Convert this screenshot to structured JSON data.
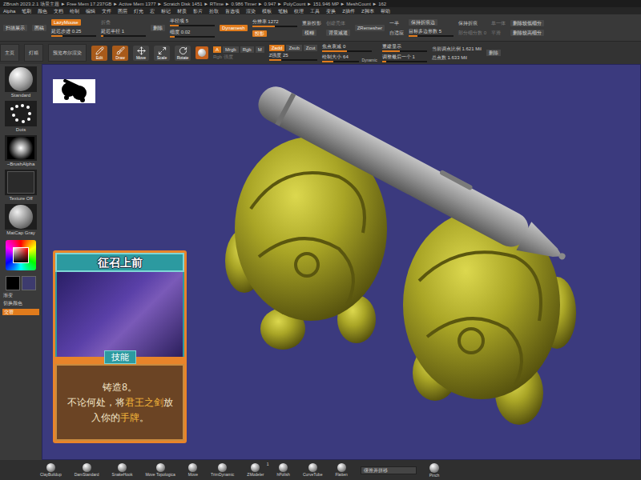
{
  "title_bar": "ZBrush 2023.2.1   场景主题   ► Free Mem 17.237GB   ► Active Mem 1377   ► Scratch Disk 1451   ► RTime ► 0.986  Timer ► 0.947   ► PolyCount ► 151.946 MP   ► MeshCount ► 162",
  "menu": [
    "Alpha",
    "笔刷",
    "颜色",
    "文档",
    "绘制",
    "编辑",
    "文件",
    "图层",
    "灯光",
    "宏",
    "标记",
    "材质",
    "影片",
    "拾取",
    "首选项",
    "渲染",
    "模板",
    "笔触",
    "纹理",
    "工具",
    "变换",
    "Z插件",
    "Z脚本",
    "帮助"
  ],
  "toolbar": [
    {
      "items": [
        {
          "kind": "button",
          "label": "扫描展示",
          "selected": false
        }
      ]
    },
    {
      "items": [
        {
          "kind": "button",
          "label": "图稿",
          "selected": false
        }
      ]
    },
    {
      "items": [
        {
          "kind": "button",
          "label": "LazyMouse",
          "selected": true
        },
        {
          "kind": "slider",
          "label": "延迟步进 0.25",
          "level": 0.25
        }
      ]
    },
    {
      "items": [
        {
          "kind": "text",
          "label": "折叠",
          "disabled": true
        },
        {
          "kind": "slider",
          "label": "延迟半径 1",
          "level": 0.05
        }
      ]
    },
    {
      "items": [
        {
          "kind": "button",
          "label": "删除",
          "selected": false
        }
      ]
    },
    {
      "items": [
        {
          "kind": "slider",
          "label": "半径项 5",
          "level": 0.2
        },
        {
          "kind": "slider",
          "label": "细度 0.02",
          "level": 0.1
        }
      ]
    },
    {
      "items": [
        {
          "kind": "button",
          "label": "Dynamesh",
          "selected": true
        }
      ]
    },
    {
      "items": [
        {
          "kind": "slider",
          "label": "分辨率 1272",
          "level": 0.5
        },
        {
          "kind": "button",
          "label": "投影",
          "selected": true
        }
      ]
    },
    {
      "items": [
        {
          "kind": "text",
          "label": "重新投影",
          "disabled": false
        },
        {
          "kind": "button",
          "label": "模糊",
          "selected": false
        }
      ]
    },
    {
      "items": [
        {
          "kind": "text",
          "label": "创建壳体",
          "disabled": true
        },
        {
          "kind": "button",
          "label": "背景减退",
          "selected": false
        }
      ]
    },
    {
      "items": [
        {
          "kind": "button",
          "label": "ZRemesher",
          "selected": false
        }
      ]
    },
    {
      "items": [
        {
          "kind": "text",
          "label": "一半",
          "disabled": false
        },
        {
          "kind": "text",
          "label": "自适应",
          "disabled": false
        }
      ]
    },
    {
      "items": [
        {
          "kind": "button",
          "label": "保持折痕边",
          "selected": false
        },
        {
          "kind": "slider",
          "label": "目标多边形数 5",
          "level": 0.2
        }
      ]
    },
    {
      "items": [
        {
          "kind": "text",
          "label": "保持折痕",
          "disabled": false
        },
        {
          "kind": "text",
          "label": "部分细分数 0",
          "disabled": true
        }
      ]
    },
    {
      "items": [
        {
          "kind": "text",
          "label": "单一体",
          "disabled": true
        },
        {
          "kind": "text",
          "label": "平滑",
          "disabled": true
        }
      ]
    },
    {
      "items": [
        {
          "kind": "button",
          "label": "删除较低细分",
          "selected": false
        },
        {
          "kind": "button",
          "label": "删除较高细分",
          "selected": false
        }
      ]
    }
  ],
  "shelf": [
    "主页",
    "灯箱",
    "预览布尔渲染"
  ],
  "modes": [
    {
      "label": "Edit",
      "selected": true,
      "kind": "pencil"
    },
    {
      "label": "Draw",
      "selected": true,
      "kind": "brush"
    },
    {
      "label": "Move",
      "selected": false,
      "kind": "move"
    },
    {
      "label": "Scale",
      "selected": false,
      "kind": "scale"
    },
    {
      "label": "Rotate",
      "selected": false,
      "kind": "rotate"
    }
  ],
  "channels": [
    {
      "label": "A",
      "selected": true
    },
    {
      "label": "Mrgb",
      "selected": false
    },
    {
      "label": "Rgb",
      "selected": false
    },
    {
      "label": "M",
      "selected": false
    }
  ],
  "z_modes": [
    {
      "label": "Zadd",
      "selected": true
    },
    {
      "label": "Zsub",
      "selected": false
    },
    {
      "label": "Zcut",
      "selected": false
    }
  ],
  "rgb_intensity": {
    "label": "Rgb 强度",
    "disabled": true
  },
  "z_intensity": {
    "label": "Z强度 25",
    "level": 0.25
  },
  "focal_shift": {
    "label": "焦点衰减 0",
    "level": 0.5
  },
  "draw_size": {
    "label": "绘制大小 64",
    "level": 0.3,
    "dynamic": "Dynamic"
  },
  "display": [
    {
      "label": "重建显示",
      "level": 0.4
    },
    {
      "label": "调整最后一个 1",
      "level": 0.1
    }
  ],
  "points": [
    {
      "label": "当前调点比例 1.621 Mil"
    },
    {
      "label": "总点数 1.633 Mil"
    }
  ],
  "delete_button": "删除",
  "tray": {
    "brushes": [
      {
        "label": "Standard",
        "kind": "sphere"
      },
      {
        "label": "Dots",
        "kind": "dots"
      },
      {
        "label": "~BrushAlpha",
        "kind": "alpha"
      },
      {
        "label": "Texture Off",
        "kind": "texture"
      },
      {
        "label": "MatCap Gray",
        "kind": "matcap"
      }
    ],
    "colors": [
      {
        "color": "#000000"
      },
      {
        "color": "#3d3b6e"
      }
    ],
    "gradient_label": "渐变",
    "switch_label": "切换颜色",
    "alternate": {
      "label": "交替",
      "selected": true
    }
  },
  "card": {
    "title": "征召上前",
    "type": "技能",
    "paragraphs": [
      [
        {
          "text": "铸造8。",
          "highlight": false
        }
      ],
      [
        {
          "text": "不论何处，将",
          "highlight": false
        },
        {
          "text": "君王之剑",
          "highlight": true
        },
        {
          "text": "放入你的",
          "highlight": false
        },
        {
          "text": "手牌",
          "highlight": true
        },
        {
          "text": "。",
          "highlight": false
        }
      ]
    ]
  },
  "bottom_shelf": [
    {
      "label": "ClayBuildup",
      "badge": ""
    },
    {
      "label": "DamStandard",
      "badge": ""
    },
    {
      "label": "SnakeHook",
      "badge": ""
    },
    {
      "label": "Move Topologica",
      "badge": ""
    },
    {
      "label": "Move",
      "badge": ""
    },
    {
      "label": "TrimDynamic",
      "badge": ""
    },
    {
      "label": "ZModeler",
      "badge": "1"
    },
    {
      "label": "hPolish",
      "badge": ""
    },
    {
      "label": "CurveTube",
      "badge": ""
    },
    {
      "label": "Flatten",
      "badge": ""
    }
  ],
  "bottom_dropdown": "缓推并拼移",
  "bottom_last": "Pinch"
}
